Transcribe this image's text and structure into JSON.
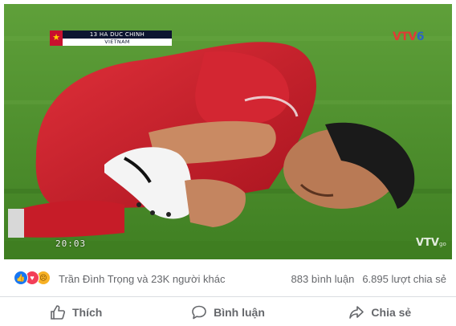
{
  "video": {
    "lower_third": {
      "player_name": "13 HA DUC CHINH",
      "team": "VIETNAM"
    },
    "channel_logo": {
      "part1": "VTV",
      "part2": "6"
    },
    "clock": "20:03",
    "watermark": {
      "main": "VTV",
      "sub": "go"
    }
  },
  "reactions": {
    "icons": [
      "like-reaction-icon",
      "love-reaction-icon",
      "sad-reaction-icon"
    ],
    "summary": "Trần Đình Trọng và 23K người khác",
    "comments": "883 bình luận",
    "shares": "6.895 lượt chia sẻ"
  },
  "actions": {
    "like_label": "Thích",
    "comment_label": "Bình luận",
    "share_label": "Chia sẻ"
  },
  "colors": {
    "facebook_blue": "#1877f2",
    "love_red": "#f33e58",
    "sad_yellow": "#f7b125",
    "text_gray": "#65676b",
    "pitch_green": "#4e8f2c",
    "jersey_red": "#c91e2a"
  }
}
